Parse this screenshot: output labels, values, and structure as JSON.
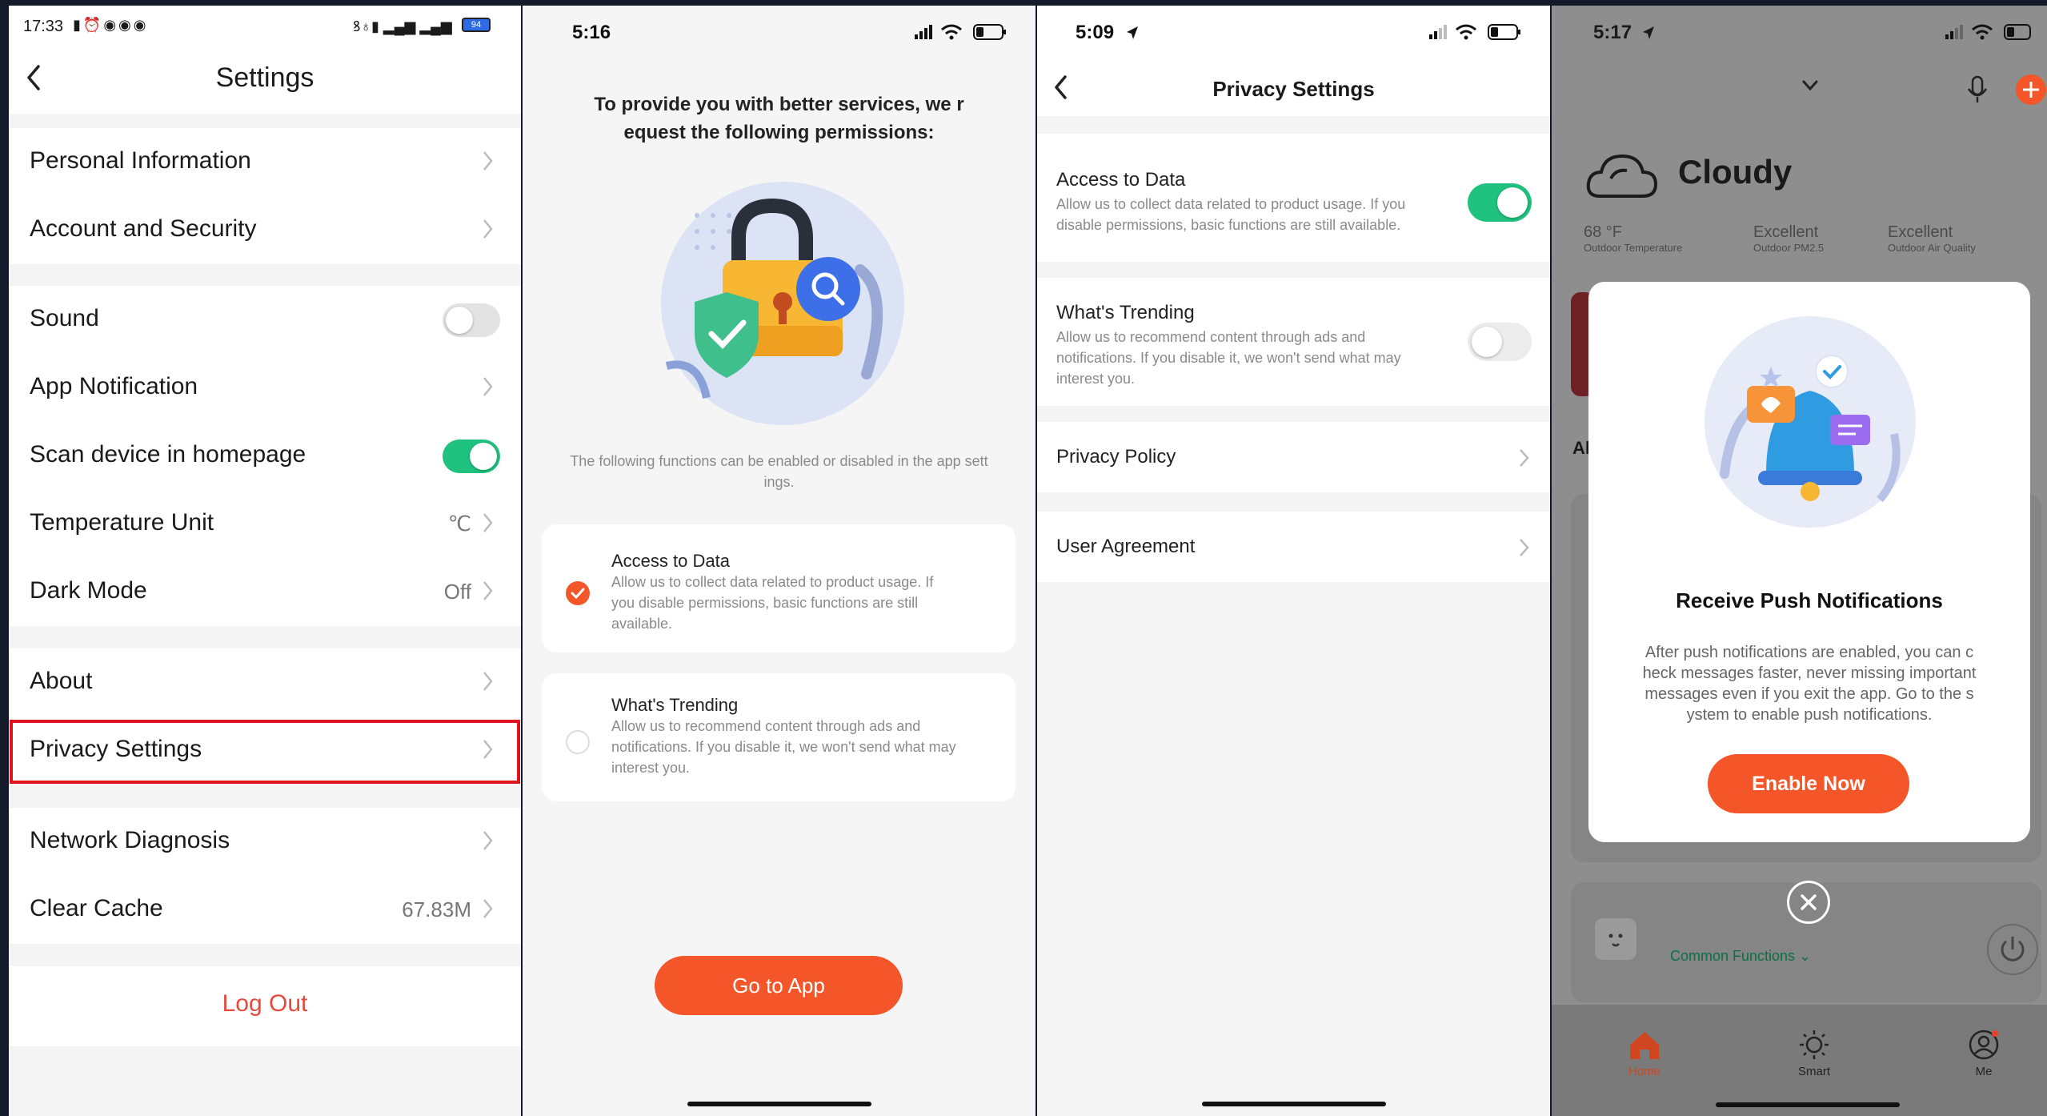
{
  "panel1": {
    "status_time": "17:33",
    "status_battery": "94",
    "title": "Settings",
    "items": [
      {
        "label": "Personal Information"
      },
      {
        "label": "Account and Security"
      },
      {
        "label": "Sound",
        "toggle": "off"
      },
      {
        "label": "App Notification"
      },
      {
        "label": "Scan device in homepage",
        "toggle": "on"
      },
      {
        "label": "Temperature Unit",
        "value": "℃"
      },
      {
        "label": "Dark Mode",
        "value": "Off"
      },
      {
        "label": "About"
      },
      {
        "label": "Privacy Settings",
        "highlighted": true
      },
      {
        "label": "Network Diagnosis"
      },
      {
        "label": "Clear Cache",
        "value": "67.83M"
      }
    ],
    "logout_label": "Log Out"
  },
  "panel2": {
    "status_time": "5:16",
    "heading_line1": "To provide you with better services, we r",
    "heading_line2": "equest the following permissions:",
    "note_line1": "The following functions can be enabled or disabled in the app sett",
    "note_line2": "ings.",
    "cards": [
      {
        "title": "Access to Data",
        "desc_lines": [
          "Allow us to collect data related to product usage. If",
          "you disable permissions, basic functions are still",
          "available."
        ],
        "checked": true
      },
      {
        "title": "What's Trending",
        "desc_lines": [
          "Allow us to recommend content through ads and",
          "notifications. If you disable it, we won't send what may",
          "interest you."
        ],
        "checked": false
      }
    ],
    "button_label": "Go to App"
  },
  "panel3": {
    "status_time": "5:09",
    "title": "Privacy Settings",
    "items": [
      {
        "title": "Access to Data",
        "desc_lines": [
          "Allow us to collect data related to product usage. If you",
          "disable permissions, basic functions are still available."
        ],
        "toggle": "on"
      },
      {
        "title": "What's Trending",
        "desc_lines": [
          "Allow us to recommend content through ads and",
          "notifications. If you disable it, we won't send what may",
          "interest you."
        ],
        "toggle": "off"
      }
    ],
    "links": [
      "Privacy Policy",
      "User Agreement"
    ]
  },
  "panel4": {
    "status_time": "5:17",
    "weather": "Cloudy",
    "stats": [
      {
        "value": "68 °F",
        "label": "Outdoor Temperature"
      },
      {
        "value": "Excellent",
        "label": "Outdoor PM2.5"
      },
      {
        "value": "Excellent",
        "label": "Outdoor Air Quality"
      }
    ],
    "partial_label": "Al",
    "modal_title": "Receive Push Notifications",
    "modal_lines": [
      "After push notifications are enabled, you can c",
      "heck messages faster, never missing important",
      "messages even if you exit the app. Go to the s",
      "ystem to enable push notifications."
    ],
    "modal_button": "Enable Now",
    "common_functions": "Common Functions",
    "nav": [
      {
        "label": "Home",
        "active": true
      },
      {
        "label": "Smart"
      },
      {
        "label": "Me"
      }
    ]
  },
  "colors": {
    "accent_orange": "#f4562a",
    "toggle_green": "#1fc27e",
    "highlight_red": "#e0141e"
  }
}
